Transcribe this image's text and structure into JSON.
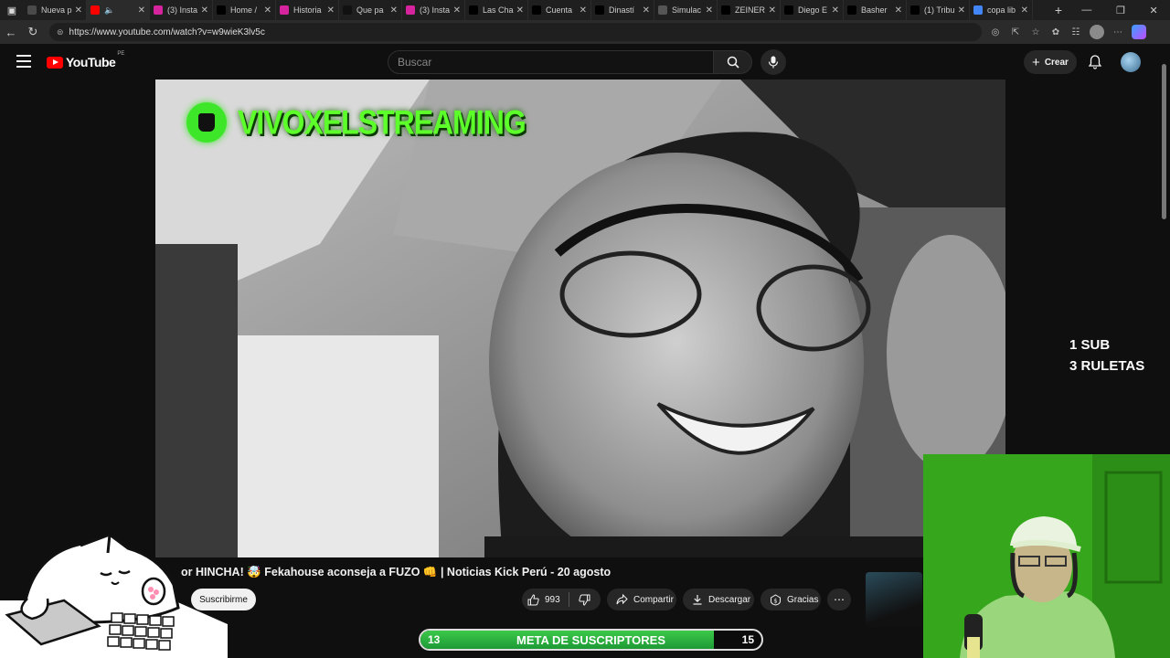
{
  "browser": {
    "tabs": [
      {
        "label": "Nueva p",
        "favicon_color": "#4a4a4a"
      },
      {
        "label": "",
        "favicon_color": "#ff0000",
        "muted": true
      },
      {
        "label": "(3) Insta",
        "favicon_color": "#d6249f"
      },
      {
        "label": "Home /",
        "favicon_color": "#000000"
      },
      {
        "label": "Historia",
        "favicon_color": "#d6249f"
      },
      {
        "label": "Que pa",
        "favicon_color": "#111111"
      },
      {
        "label": "(3) Insta",
        "favicon_color": "#d6249f"
      },
      {
        "label": "Las Cha",
        "favicon_color": "#000000"
      },
      {
        "label": "Cuenta",
        "favicon_color": "#000000"
      },
      {
        "label": "Dinastí",
        "favicon_color": "#000000"
      },
      {
        "label": "Simulac",
        "favicon_color": "#555555"
      },
      {
        "label": "ZEINER",
        "favicon_color": "#000000"
      },
      {
        "label": "Diego E",
        "favicon_color": "#000000"
      },
      {
        "label": "Basher",
        "favicon_color": "#000000"
      },
      {
        "label": "(1) Tribu",
        "favicon_color": "#000000"
      },
      {
        "label": "copa lib",
        "favicon_color": "#4285f4"
      }
    ],
    "url": "https://www.youtube.com/watch?v=w9wieK3lv5c"
  },
  "youtube": {
    "logo_text": "YouTube",
    "country_code": "PE",
    "search_placeholder": "Buscar",
    "create_label": "Crear"
  },
  "video": {
    "channel_overlay": "VIVOXELSTREAMING",
    "side_overlay_line1": "1 SUB",
    "side_overlay_line2": "3 RULETAS",
    "title": "or HINCHA! 🤯 Fekahouse aconseja a FUZO 👊 | Noticias Kick Perú - 20 agosto",
    "subscribe_label": "Suscribirme",
    "likes": "993",
    "share_label": "Compartir",
    "download_label": "Descargar",
    "thanks_label": "Gracias"
  },
  "goal": {
    "current": "13",
    "label": "META DE SUSCRIPTORES",
    "target": "15",
    "progress_fraction": 0.86
  },
  "colors": {
    "youtube_red": "#ff0000",
    "overlay_green": "#5cff2a",
    "goal_fill": "#2bb543"
  }
}
